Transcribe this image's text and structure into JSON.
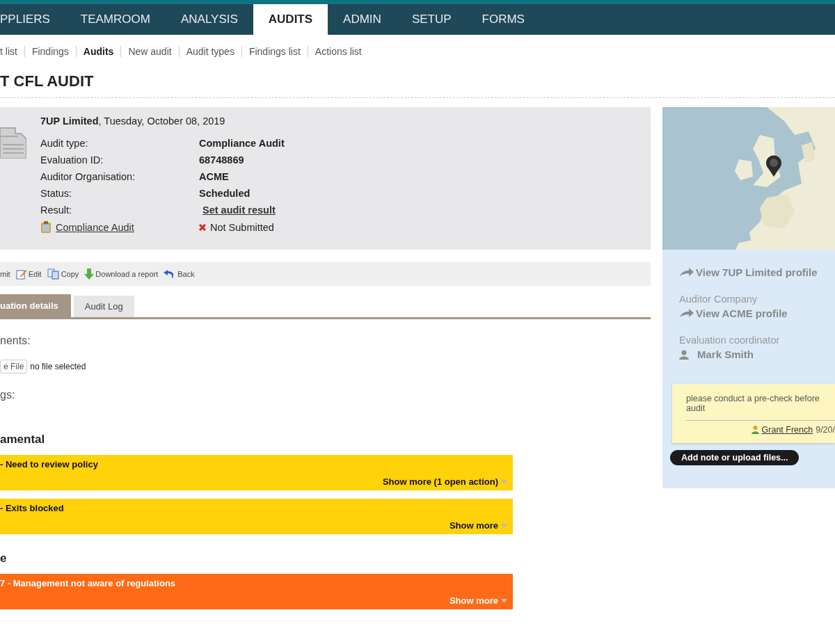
{
  "nav": [
    {
      "label": "PPLIERS",
      "selected": false
    },
    {
      "label": "TEAMROOM",
      "selected": false
    },
    {
      "label": "ANALYSIS",
      "selected": false
    },
    {
      "label": "AUDITS",
      "selected": true
    },
    {
      "label": "ADMIN",
      "selected": false
    },
    {
      "label": "SETUP",
      "selected": false
    },
    {
      "label": "FORMS",
      "selected": false
    }
  ],
  "subnav": [
    {
      "label": "t list",
      "selected": false
    },
    {
      "label": "Findings",
      "selected": false
    },
    {
      "label": "Audits",
      "selected": true
    },
    {
      "label": "New audit",
      "selected": false
    },
    {
      "label": "Audit types",
      "selected": false
    },
    {
      "label": "Findings list",
      "selected": false
    },
    {
      "label": "Actions list",
      "selected": false
    }
  ],
  "page_title": "T CFL AUDIT",
  "info": {
    "heading": "**7UP Limited**, Tuesday, October 08, 2019",
    "rows": [
      {
        "label": "Audit type:",
        "value": "Compliance Audit",
        "kind": "text"
      },
      {
        "label": "Evaluation ID:",
        "value": "68748869",
        "kind": "text"
      },
      {
        "label": "Auditor Organisation:",
        "value": "ACME",
        "kind": "text"
      },
      {
        "label": "Status:",
        "value": "Scheduled",
        "kind": "text"
      },
      {
        "label": "Result:",
        "value": "Set audit result",
        "kind": "link"
      }
    ],
    "document_link": "Compliance Audit",
    "submission_status": "Not Submitted"
  },
  "toolbar": [
    {
      "label": "mit",
      "kind": "cut"
    },
    {
      "label": "Edit",
      "kind": "edit"
    },
    {
      "label": "Copy",
      "kind": "copy"
    },
    {
      "label": "Download a report",
      "kind": "download"
    },
    {
      "label": "Back",
      "kind": "back"
    }
  ],
  "tabs": [
    {
      "label": "uation details",
      "selected": true
    },
    {
      "label": "Audit Log",
      "selected": false
    }
  ],
  "attachments": {
    "label": "nents:",
    "button": "e File",
    "status": "no file selected"
  },
  "findings": {
    "label": "gs:",
    "groups": [
      {
        "heading": "amental",
        "items": [
          {
            "title": "- Need to review policy",
            "more": "Show more (1 open action)",
            "color": "#ffd20a"
          },
          {
            "title": "- Exits blocked",
            "more": "Show more",
            "color": "#ffd20a"
          }
        ]
      },
      {
        "heading": "e",
        "items": [
          {
            "title": "7 - Management not aware of regulations",
            "more": "Show more",
            "color": "#ff6a16"
          }
        ]
      }
    ]
  },
  "side": {
    "profile_link": "View 7UP Limited profile",
    "auditor_label": "Auditor Company",
    "auditor_link": "View ACME profile",
    "coordinator_label": "Evaluation coordinator",
    "coordinator": "Mark Smith",
    "note": {
      "text": "please conduct a pre-check before audit",
      "author": "Grant French",
      "date": "9/20/"
    },
    "add_button": "Add note or upload files..."
  }
}
